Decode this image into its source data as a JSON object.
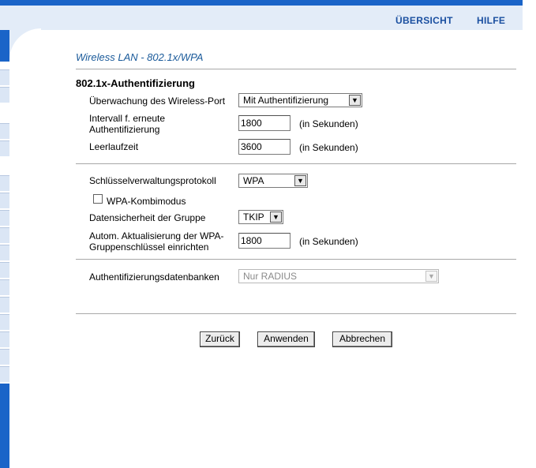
{
  "header": {
    "nav_overview": "ÜBERSICHT",
    "nav_help": "HILFE"
  },
  "page": {
    "title": "Wireless LAN - 802.1x/WPA"
  },
  "auth": {
    "section_title": "802.1x-Authentifizierung",
    "port_monitor_label": "Überwachung des Wireless-Port",
    "port_monitor_value": "Mit Authentifizierung",
    "reauth_label_1": "Intervall f. erneute",
    "reauth_label_2": "Authentifizierung",
    "reauth_value": "1800",
    "reauth_unit": "(in Sekunden)",
    "idle_label": "Leerlaufzeit",
    "idle_value": "3600",
    "idle_unit": "(in Sekunden)"
  },
  "key": {
    "protocol_label": "Schlüsselverwaltungsprotokoll",
    "protocol_value": "WPA",
    "combo_label": "WPA-Kombimodus",
    "combo_checked": false,
    "group_security_label": "Datensicherheit der Gruppe",
    "group_security_value": "TKIP",
    "rekey_label_1": "Autom. Aktualisierung der WPA-",
    "rekey_label_2": "Gruppenschlüssel einrichten",
    "rekey_value": "1800",
    "rekey_unit": "(in Sekunden)"
  },
  "db": {
    "label": "Authentifizierungsdatenbanken",
    "value": "Nur RADIUS"
  },
  "buttons": {
    "back": "Zurück",
    "apply": "Anwenden",
    "cancel": "Abbrechen"
  },
  "colors": {
    "accent": "#1a64c8",
    "title": "#1a5a9a",
    "nav": "#1a4fa0"
  }
}
